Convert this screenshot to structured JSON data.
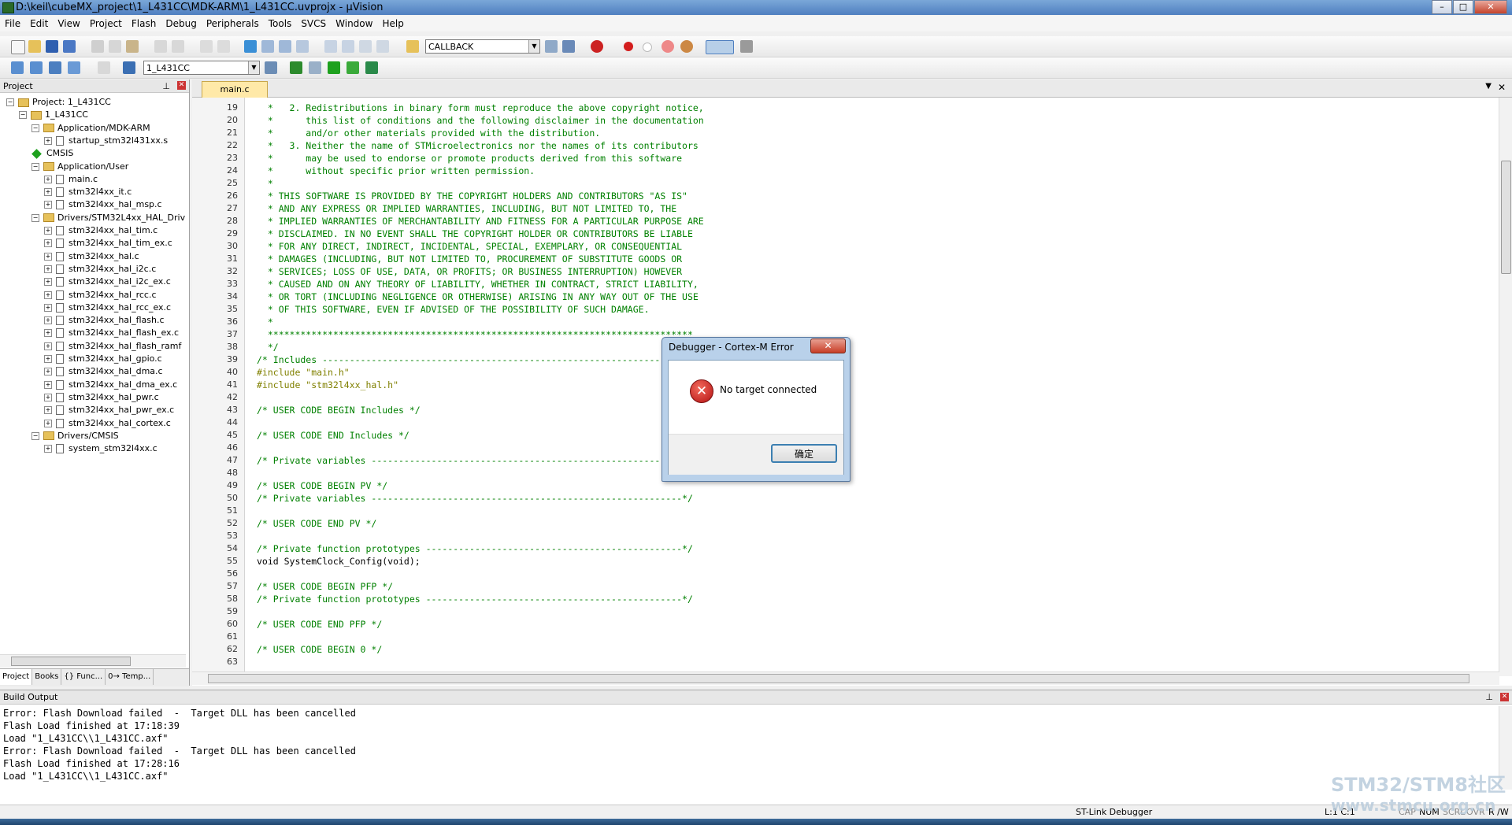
{
  "window": {
    "title": "D:\\keil\\cubeMX_project\\1_L431CC\\MDK-ARM\\1_L431CC.uvprojx - µVision"
  },
  "menu": [
    "File",
    "Edit",
    "View",
    "Project",
    "Flash",
    "Debug",
    "Peripherals",
    "Tools",
    "SVCS",
    "Window",
    "Help"
  ],
  "toolbar": {
    "find_combo": "CALLBACK",
    "target_combo": "1_L431CC"
  },
  "project": {
    "header": "Project",
    "tree": [
      {
        "label": "Project: 1_L431CC",
        "type": "root",
        "level": 0
      },
      {
        "label": "1_L431CC",
        "type": "target",
        "level": 1
      },
      {
        "label": "Application/MDK-ARM",
        "type": "folder",
        "level": 2
      },
      {
        "label": "startup_stm32l431xx.s",
        "type": "file",
        "level": 3
      },
      {
        "label": "CMSIS",
        "type": "component",
        "level": 2
      },
      {
        "label": "Application/User",
        "type": "folder",
        "level": 2
      },
      {
        "label": "main.c",
        "type": "file",
        "level": 3
      },
      {
        "label": "stm32l4xx_it.c",
        "type": "file",
        "level": 3
      },
      {
        "label": "stm32l4xx_hal_msp.c",
        "type": "file",
        "level": 3
      },
      {
        "label": "Drivers/STM32L4xx_HAL_Driv",
        "type": "folder",
        "level": 2
      },
      {
        "label": "stm32l4xx_hal_tim.c",
        "type": "file",
        "level": 3
      },
      {
        "label": "stm32l4xx_hal_tim_ex.c",
        "type": "file",
        "level": 3
      },
      {
        "label": "stm32l4xx_hal.c",
        "type": "file",
        "level": 3
      },
      {
        "label": "stm32l4xx_hal_i2c.c",
        "type": "file",
        "level": 3
      },
      {
        "label": "stm32l4xx_hal_i2c_ex.c",
        "type": "file",
        "level": 3
      },
      {
        "label": "stm32l4xx_hal_rcc.c",
        "type": "file",
        "level": 3
      },
      {
        "label": "stm32l4xx_hal_rcc_ex.c",
        "type": "file",
        "level": 3
      },
      {
        "label": "stm32l4xx_hal_flash.c",
        "type": "file",
        "level": 3
      },
      {
        "label": "stm32l4xx_hal_flash_ex.c",
        "type": "file",
        "level": 3
      },
      {
        "label": "stm32l4xx_hal_flash_ramf",
        "type": "file",
        "level": 3
      },
      {
        "label": "stm32l4xx_hal_gpio.c",
        "type": "file",
        "level": 3
      },
      {
        "label": "stm32l4xx_hal_dma.c",
        "type": "file",
        "level": 3
      },
      {
        "label": "stm32l4xx_hal_dma_ex.c",
        "type": "file",
        "level": 3
      },
      {
        "label": "stm32l4xx_hal_pwr.c",
        "type": "file",
        "level": 3
      },
      {
        "label": "stm32l4xx_hal_pwr_ex.c",
        "type": "file",
        "level": 3
      },
      {
        "label": "stm32l4xx_hal_cortex.c",
        "type": "file",
        "level": 3
      },
      {
        "label": "Drivers/CMSIS",
        "type": "folder",
        "level": 2
      },
      {
        "label": "system_stm32l4xx.c",
        "type": "file",
        "level": 3
      }
    ],
    "tabs": [
      "Project",
      "Books",
      "{} Func...",
      "0→ Temp..."
    ]
  },
  "editor": {
    "tab": "main.c",
    "lines": [
      {
        "n": "19",
        "t": "  *   2. Redistributions in binary form must reproduce the above copyright notice,",
        "k": "c"
      },
      {
        "n": "20",
        "t": "  *      this list of conditions and the following disclaimer in the documentation",
        "k": "c"
      },
      {
        "n": "21",
        "t": "  *      and/or other materials provided with the distribution.",
        "k": "c"
      },
      {
        "n": "22",
        "t": "  *   3. Neither the name of STMicroelectronics nor the names of its contributors",
        "k": "c"
      },
      {
        "n": "23",
        "t": "  *      may be used to endorse or promote products derived from this software",
        "k": "c"
      },
      {
        "n": "24",
        "t": "  *      without specific prior written permission.",
        "k": "c"
      },
      {
        "n": "25",
        "t": "  *",
        "k": "c"
      },
      {
        "n": "26",
        "t": "  * THIS SOFTWARE IS PROVIDED BY THE COPYRIGHT HOLDERS AND CONTRIBUTORS \"AS IS\"",
        "k": "c"
      },
      {
        "n": "27",
        "t": "  * AND ANY EXPRESS OR IMPLIED WARRANTIES, INCLUDING, BUT NOT LIMITED TO, THE",
        "k": "c"
      },
      {
        "n": "28",
        "t": "  * IMPLIED WARRANTIES OF MERCHANTABILITY AND FITNESS FOR A PARTICULAR PURPOSE ARE",
        "k": "c"
      },
      {
        "n": "29",
        "t": "  * DISCLAIMED. IN NO EVENT SHALL THE COPYRIGHT HOLDER OR CONTRIBUTORS BE LIABLE",
        "k": "c"
      },
      {
        "n": "30",
        "t": "  * FOR ANY DIRECT, INDIRECT, INCIDENTAL, SPECIAL, EXEMPLARY, OR CONSEQUENTIAL",
        "k": "c"
      },
      {
        "n": "31",
        "t": "  * DAMAGES (INCLUDING, BUT NOT LIMITED TO, PROCUREMENT OF SUBSTITUTE GOODS OR",
        "k": "c"
      },
      {
        "n": "32",
        "t": "  * SERVICES; LOSS OF USE, DATA, OR PROFITS; OR BUSINESS INTERRUPTION) HOWEVER",
        "k": "c"
      },
      {
        "n": "33",
        "t": "  * CAUSED AND ON ANY THEORY OF LIABILITY, WHETHER IN CONTRACT, STRICT LIABILITY,",
        "k": "c"
      },
      {
        "n": "34",
        "t": "  * OR TORT (INCLUDING NEGLIGENCE OR OTHERWISE) ARISING IN ANY WAY OUT OF THE USE",
        "k": "c"
      },
      {
        "n": "35",
        "t": "  * OF THIS SOFTWARE, EVEN IF ADVISED OF THE POSSIBILITY OF SUCH DAMAGE.",
        "k": "c"
      },
      {
        "n": "36",
        "t": "  *",
        "k": "c"
      },
      {
        "n": "37",
        "t": "  ******************************************************************************",
        "k": "c"
      },
      {
        "n": "38",
        "t": "  */",
        "k": "c"
      },
      {
        "n": "39",
        "t": "/* Includes ------------------------------------------------------------------*/",
        "k": "c"
      },
      {
        "n": "40",
        "t": "#include \"main.h\"",
        "k": "p"
      },
      {
        "n": "41",
        "t": "#include \"stm32l4xx_hal.h\"",
        "k": "p"
      },
      {
        "n": "42",
        "t": "",
        "k": "c"
      },
      {
        "n": "43",
        "t": "/* USER CODE BEGIN Includes */",
        "k": "c"
      },
      {
        "n": "44",
        "t": "",
        "k": "c"
      },
      {
        "n": "45",
        "t": "/* USER CODE END Includes */",
        "k": "c"
      },
      {
        "n": "46",
        "t": "",
        "k": "c"
      },
      {
        "n": "47",
        "t": "/* Private variables ---------------------------------------------------------*/",
        "k": "c"
      },
      {
        "n": "48",
        "t": "",
        "k": "c"
      },
      {
        "n": "49",
        "t": "/* USER CODE BEGIN PV */",
        "k": "c"
      },
      {
        "n": "50",
        "t": "/* Private variables ---------------------------------------------------------*/",
        "k": "c"
      },
      {
        "n": "51",
        "t": "",
        "k": "c"
      },
      {
        "n": "52",
        "t": "/* USER CODE END PV */",
        "k": "c"
      },
      {
        "n": "53",
        "t": "",
        "k": "c"
      },
      {
        "n": "54",
        "t": "/* Private function prototypes -----------------------------------------------*/",
        "k": "c"
      },
      {
        "n": "55",
        "t": "void SystemClock_Config(void);",
        "k": "k"
      },
      {
        "n": "56",
        "t": "",
        "k": "c"
      },
      {
        "n": "57",
        "t": "/* USER CODE BEGIN PFP */",
        "k": "c"
      },
      {
        "n": "58",
        "t": "/* Private function prototypes -----------------------------------------------*/",
        "k": "c"
      },
      {
        "n": "59",
        "t": "",
        "k": "c"
      },
      {
        "n": "60",
        "t": "/* USER CODE END PFP */",
        "k": "c"
      },
      {
        "n": "61",
        "t": "",
        "k": "c"
      },
      {
        "n": "62",
        "t": "/* USER CODE BEGIN 0 */",
        "k": "c"
      },
      {
        "n": "63",
        "t": "",
        "k": "c"
      }
    ]
  },
  "build": {
    "header": "Build Output",
    "lines": [
      "Error: Flash Download failed  -  Target DLL has been cancelled",
      "Flash Load finished at 17:18:39",
      "Load \"1_L431CC\\\\1_L431CC.axf\"",
      "Error: Flash Download failed  -  Target DLL has been cancelled",
      "Flash Load finished at 17:28:16",
      "Load \"1_L431CC\\\\1_L431CC.axf\""
    ]
  },
  "status": {
    "debugger": "ST-Link Debugger",
    "position": "L:1 C:1",
    "caps": "CAP",
    "num": "NUM",
    "scrl": "SCRL",
    "ovr": "OVR",
    "rw": "R /W"
  },
  "dialog": {
    "title": "Debugger - Cortex-M Error",
    "close": "✕",
    "message": "No target connected",
    "ok": "确定"
  },
  "watermark": {
    "line1": "STM32/STM8社区",
    "line2": "www.stmcu.org.cn"
  },
  "colors": {
    "comment": "#008000",
    "preprocessor": "#808000",
    "string": "#8b0000",
    "keyword": "#00008b",
    "tab_active": "#ffe9a8"
  }
}
